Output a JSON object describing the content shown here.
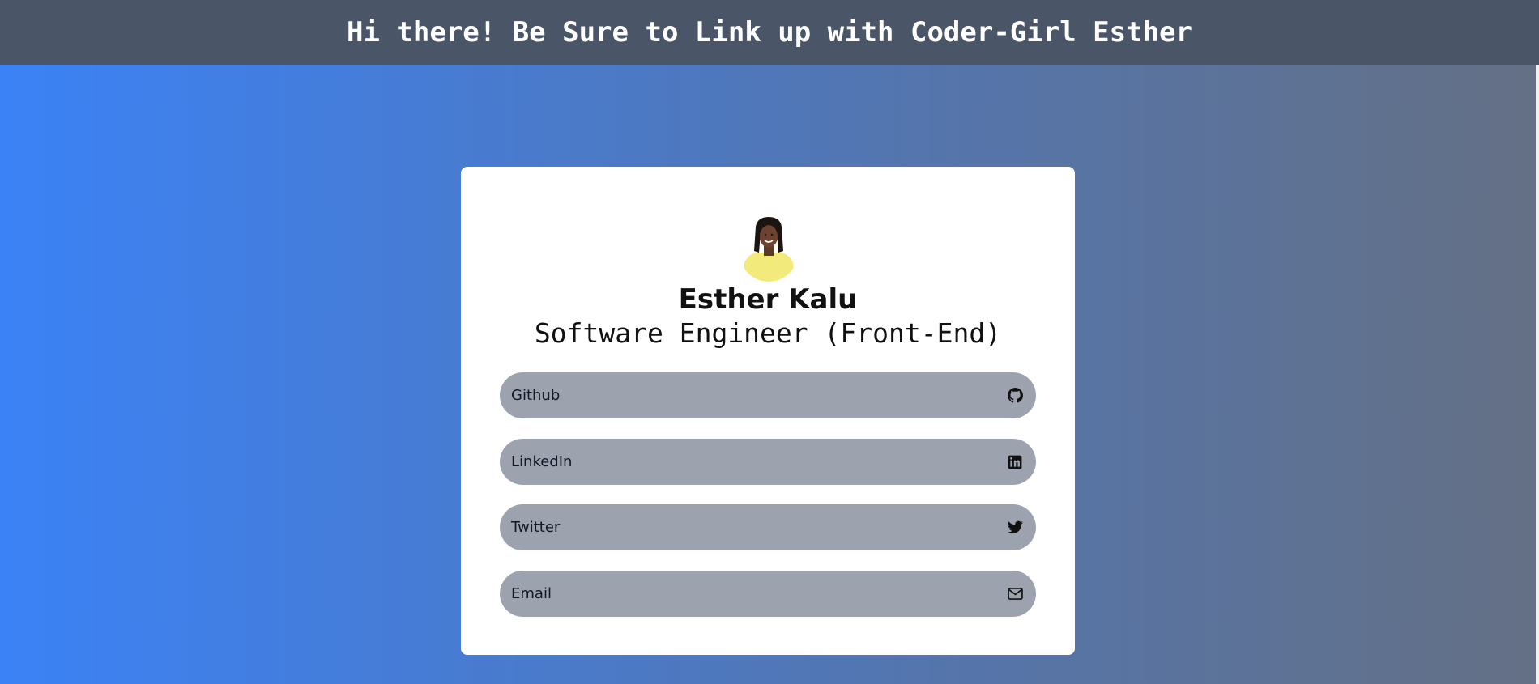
{
  "header": {
    "title": "Hi there! Be Sure to Link up with Coder-Girl Esther"
  },
  "profile": {
    "name": "Esther Kalu",
    "role": "Software Engineer (Front-End)"
  },
  "links": [
    {
      "label": "Github",
      "icon": "github-icon"
    },
    {
      "label": "LinkedIn",
      "icon": "linkedin-icon"
    },
    {
      "label": "Twitter",
      "icon": "twitter-icon"
    },
    {
      "label": "Email",
      "icon": "envelope-icon"
    }
  ],
  "colors": {
    "header_bg": "#4a5568",
    "gradient_start": "#3b82f6",
    "gradient_end": "#647085",
    "pill_bg": "#9ca3af",
    "card_bg": "#ffffff"
  }
}
